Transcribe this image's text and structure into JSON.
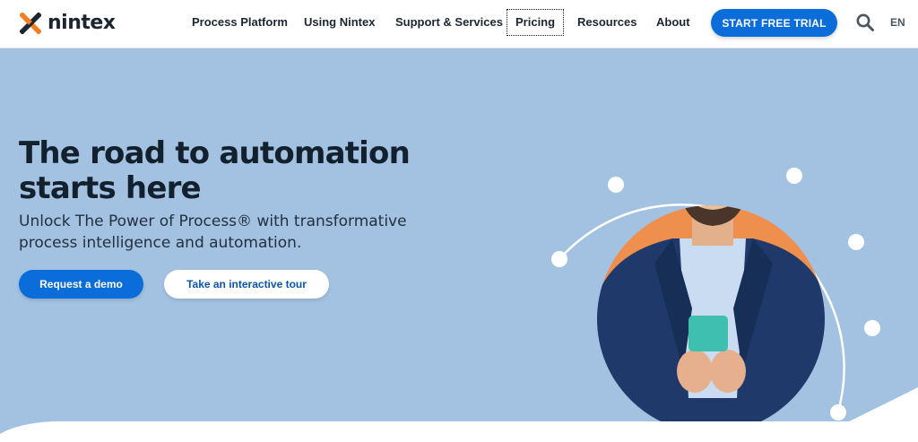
{
  "brand": {
    "name": "nintex",
    "icon": "nintex-x-logo-icon",
    "colors": {
      "orange": "#f47d20",
      "navy": "#1c2532"
    }
  },
  "nav": {
    "items": [
      {
        "label": "Process Platform"
      },
      {
        "label": "Using Nintex"
      },
      {
        "label": "Support & Services"
      },
      {
        "label": "Pricing"
      },
      {
        "label": "Resources"
      },
      {
        "label": "About"
      }
    ],
    "cta_label": "START FREE TRIAL",
    "search_icon": "search-icon",
    "language": "EN"
  },
  "hero": {
    "title_line1": "The road to automation",
    "title_line2": "starts here",
    "subtitle_line1": "Unlock The Power of Process® with transformative",
    "subtitle_line2": "process intelligence and automation.",
    "primary_button": "Request a demo",
    "secondary_button": "Take an interactive tour",
    "image": "man-smiling-at-phone-photo",
    "colors": {
      "background": "#a3c2e2",
      "accent": "#ee8f4e",
      "button": "#0a6dd9"
    }
  }
}
